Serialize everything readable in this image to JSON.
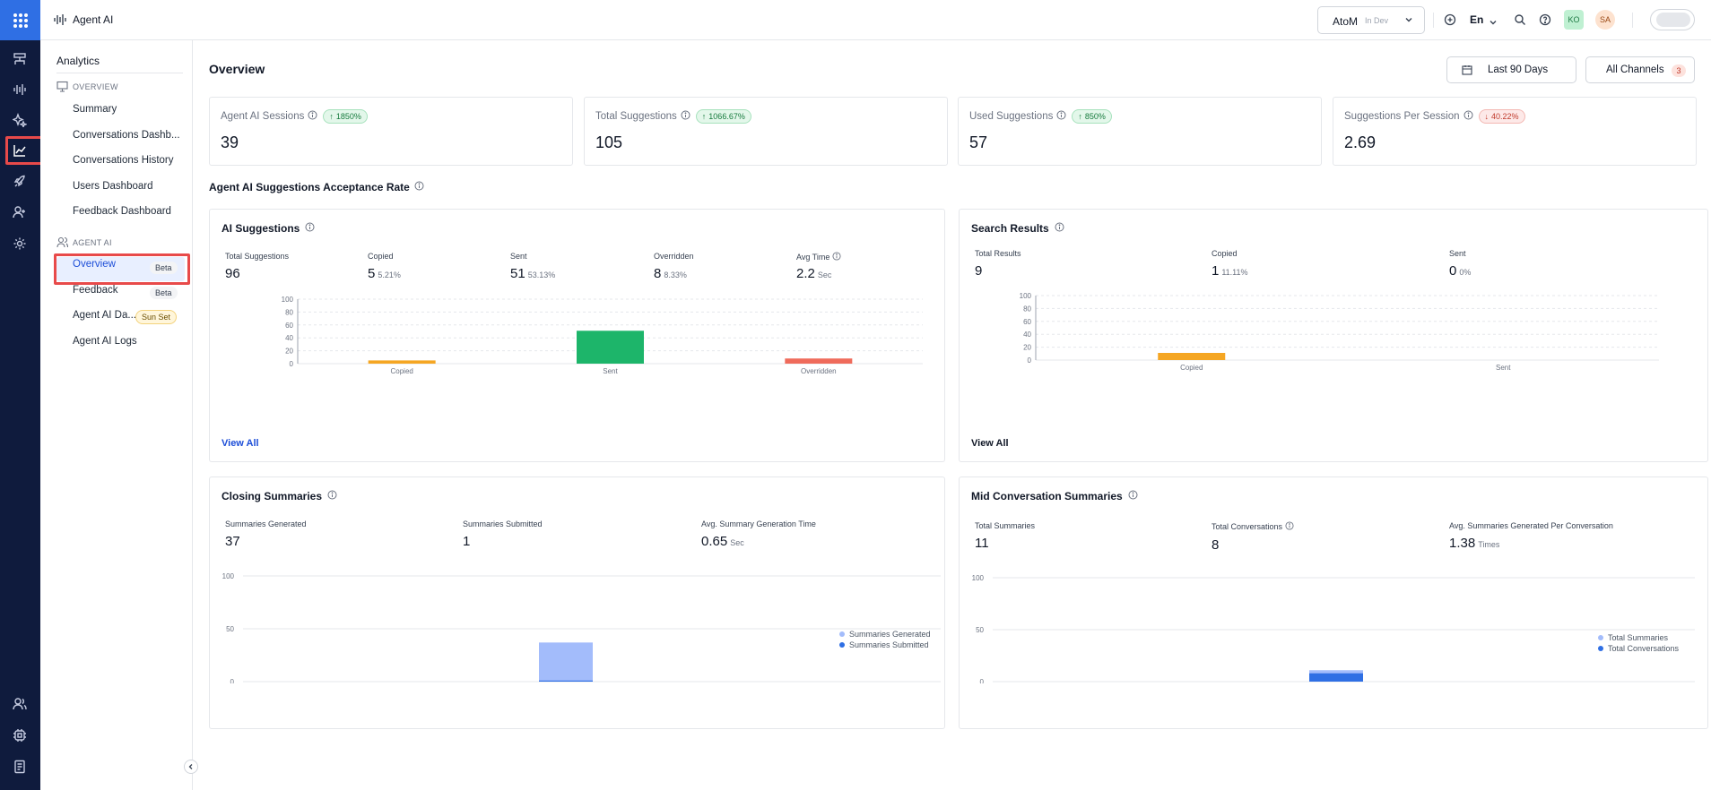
{
  "app": {
    "title": "Agent AI"
  },
  "topbar": {
    "workspace_name": "AtoM",
    "workspace_status": "In Dev",
    "language": "En",
    "avatar1": "KO",
    "avatar2": "SA"
  },
  "sidebar": {
    "heading": "Analytics",
    "overview_section": "OVERVIEW",
    "overview_items": [
      {
        "label": "Summary"
      },
      {
        "label": "Conversations Dashb..."
      },
      {
        "label": "Conversations History"
      },
      {
        "label": "Users Dashboard"
      },
      {
        "label": "Feedback Dashboard"
      }
    ],
    "agent_section": "AGENT AI",
    "agent_items": [
      {
        "label": "Overview",
        "badge": "Beta"
      },
      {
        "label": "Feedback",
        "badge": "Beta"
      },
      {
        "label": "Agent AI Da...",
        "badge": "Sun Set"
      },
      {
        "label": "Agent AI Logs"
      }
    ]
  },
  "page": {
    "title": "Overview",
    "date_range": "Last 90 Days",
    "channels": "All Channels",
    "channels_count": "3"
  },
  "kpis": [
    {
      "label": "Agent AI Sessions",
      "change": "1850%",
      "direction": "up",
      "value": "39"
    },
    {
      "label": "Total Suggestions",
      "change": "1066.67%",
      "direction": "up",
      "value": "105"
    },
    {
      "label": "Used Suggestions",
      "change": "850%",
      "direction": "up",
      "value": "57"
    },
    {
      "label": "Suggestions Per Session",
      "change": "40.22%",
      "direction": "down",
      "value": "2.69"
    }
  ],
  "acceptance_title": "Agent AI Suggestions Acceptance Rate",
  "ai_suggestions": {
    "title": "AI Suggestions",
    "metrics": [
      {
        "label": "Total Suggestions",
        "value": "96",
        "sub": ""
      },
      {
        "label": "Copied",
        "value": "5",
        "sub": "5.21%"
      },
      {
        "label": "Sent",
        "value": "51",
        "sub": "53.13%"
      },
      {
        "label": "Overridden",
        "value": "8",
        "sub": "8.33%"
      },
      {
        "label": "Avg Time",
        "value": "2.2",
        "sub": "Sec"
      }
    ],
    "view_all": "View All"
  },
  "search_results": {
    "title": "Search Results",
    "metrics": [
      {
        "label": "Total Results",
        "value": "9",
        "sub": ""
      },
      {
        "label": "Copied",
        "value": "1",
        "sub": "11.11%"
      },
      {
        "label": "Sent",
        "value": "0",
        "sub": "0%"
      }
    ],
    "view_all": "View All"
  },
  "closing_summaries": {
    "title": "Closing Summaries",
    "metrics": [
      {
        "label": "Summaries Generated",
        "value": "37",
        "sub": ""
      },
      {
        "label": "Summaries Submitted",
        "value": "1",
        "sub": ""
      },
      {
        "label": "Avg. Summary Generation Time",
        "value": "0.65",
        "sub": "Sec"
      }
    ]
  },
  "mid_summaries": {
    "title": "Mid Conversation Summaries",
    "metrics": [
      {
        "label": "Total Summaries",
        "value": "11",
        "sub": ""
      },
      {
        "label": "Total Conversations",
        "value": "8",
        "sub": ""
      },
      {
        "label": "Avg. Summaries Generated Per Conversation",
        "value": "1.38",
        "sub": "Times"
      }
    ]
  },
  "colors": {
    "copied": "#f5a623",
    "sent": "#1db56a",
    "overridden": "#ef6b5b",
    "generated": "#a3bcfb",
    "submitted": "#2f6fe4",
    "accent": "#1d4ed8"
  },
  "chart_data": [
    {
      "type": "bar",
      "title": "AI Suggestions",
      "categories": [
        "Copied",
        "Sent",
        "Overridden"
      ],
      "values": [
        5,
        51,
        8
      ],
      "ylim": [
        0,
        100
      ],
      "yticks": [
        0,
        20,
        40,
        60,
        80,
        100
      ],
      "grid": true
    },
    {
      "type": "bar",
      "title": "Search Results",
      "categories": [
        "Copied",
        "Sent"
      ],
      "values": [
        11.11,
        0
      ],
      "ylim": [
        0,
        100
      ],
      "yticks": [
        0,
        20,
        40,
        60,
        80,
        100
      ],
      "grid": true
    },
    {
      "type": "bar",
      "title": "Closing Summaries",
      "categories": [
        ""
      ],
      "series": [
        {
          "name": "Summaries Generated",
          "values": [
            37
          ]
        },
        {
          "name": "Summaries Submitted",
          "values": [
            1
          ]
        }
      ],
      "ylim": [
        0,
        100
      ],
      "yticks": [
        0,
        50,
        100
      ],
      "legend": "right"
    },
    {
      "type": "bar",
      "title": "Mid Conversation Summaries",
      "categories": [
        ""
      ],
      "series": [
        {
          "name": "Total Summaries",
          "values": [
            11
          ]
        },
        {
          "name": "Total Conversations",
          "values": [
            8
          ]
        }
      ],
      "ylim": [
        0,
        100
      ],
      "yticks": [
        0,
        50,
        100
      ],
      "legend": "right"
    }
  ]
}
